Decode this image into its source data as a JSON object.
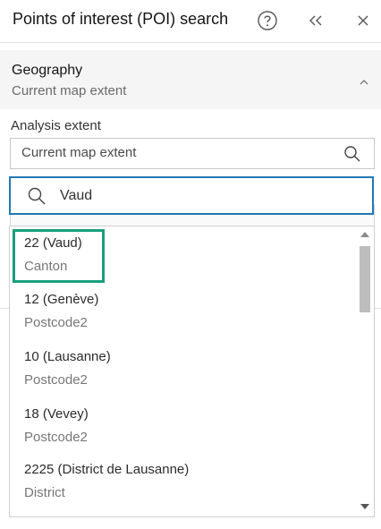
{
  "header": {
    "title": "Points of interest (POI) search",
    "help_icon": "help-circle-icon",
    "collapse_icon": "double-chevron-left-icon",
    "close_icon": "close-icon"
  },
  "geography": {
    "title": "Geography",
    "subtitle": "Current map extent",
    "toggle_icon": "chevron-up-icon"
  },
  "analysis_extent": {
    "label": "Analysis extent",
    "value": "Current map extent",
    "icon": "search-icon"
  },
  "search": {
    "value": "Vaud",
    "icon": "search-icon",
    "accent_color": "#1f78b4"
  },
  "results": [
    {
      "name": "22 (Vaud)",
      "type": "Canton",
      "highlighted": true
    },
    {
      "name": "12 (Genève)",
      "type": "Postcode2"
    },
    {
      "name": "10 (Lausanne)",
      "type": "Postcode2"
    },
    {
      "name": "18 (Vevey)",
      "type": "Postcode2"
    },
    {
      "name": "2225 (District de Lausanne)",
      "type": "District"
    }
  ],
  "highlight_color": "#1a9e7c"
}
